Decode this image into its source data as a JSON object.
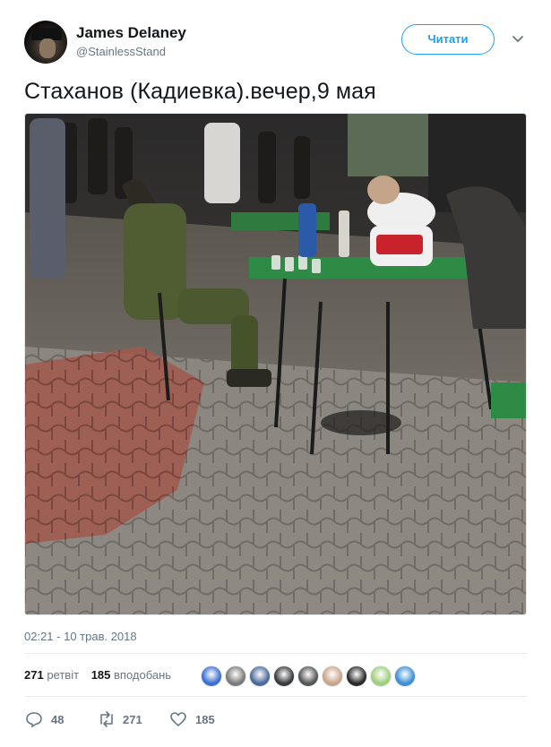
{
  "author": {
    "display_name": "James Delaney",
    "handle": "@StainlessStand"
  },
  "follow_button": {
    "label": "Читати"
  },
  "tweet": {
    "text": "Стаханов (Кадиевка).вечер,9 мая",
    "timestamp": "02:21 - 10 трав. 2018"
  },
  "stats": {
    "retweets_count": "271",
    "retweets_label": "ретвіт",
    "likes_count": "185",
    "likes_label": "вподобань"
  },
  "liker_avatars": [
    {
      "icon": "emblem-avatar",
      "color": "#3b6fd1"
    },
    {
      "icon": "person-avatar",
      "color": "#7a7a7a"
    },
    {
      "icon": "mountains-avatar",
      "color": "#4b6a9b"
    },
    {
      "icon": "raccoon-avatar",
      "color": "#3a3a3a"
    },
    {
      "icon": "portrait-avatar",
      "color": "#555555"
    },
    {
      "icon": "person-avatar",
      "color": "#c9a58a"
    },
    {
      "icon": "bearded-avatar",
      "color": "#2c2a28"
    },
    {
      "icon": "cartoon-avatar",
      "color": "#9fcf7a"
    },
    {
      "icon": "landscape-avatar",
      "color": "#3d8fd6"
    }
  ],
  "actions": {
    "replies_count": "48",
    "retweets_count": "271",
    "likes_count": "185"
  },
  "colors": {
    "accent": "#1da1f2",
    "text": "#14171a",
    "secondary": "#657786",
    "divider": "#e6ecf0"
  }
}
